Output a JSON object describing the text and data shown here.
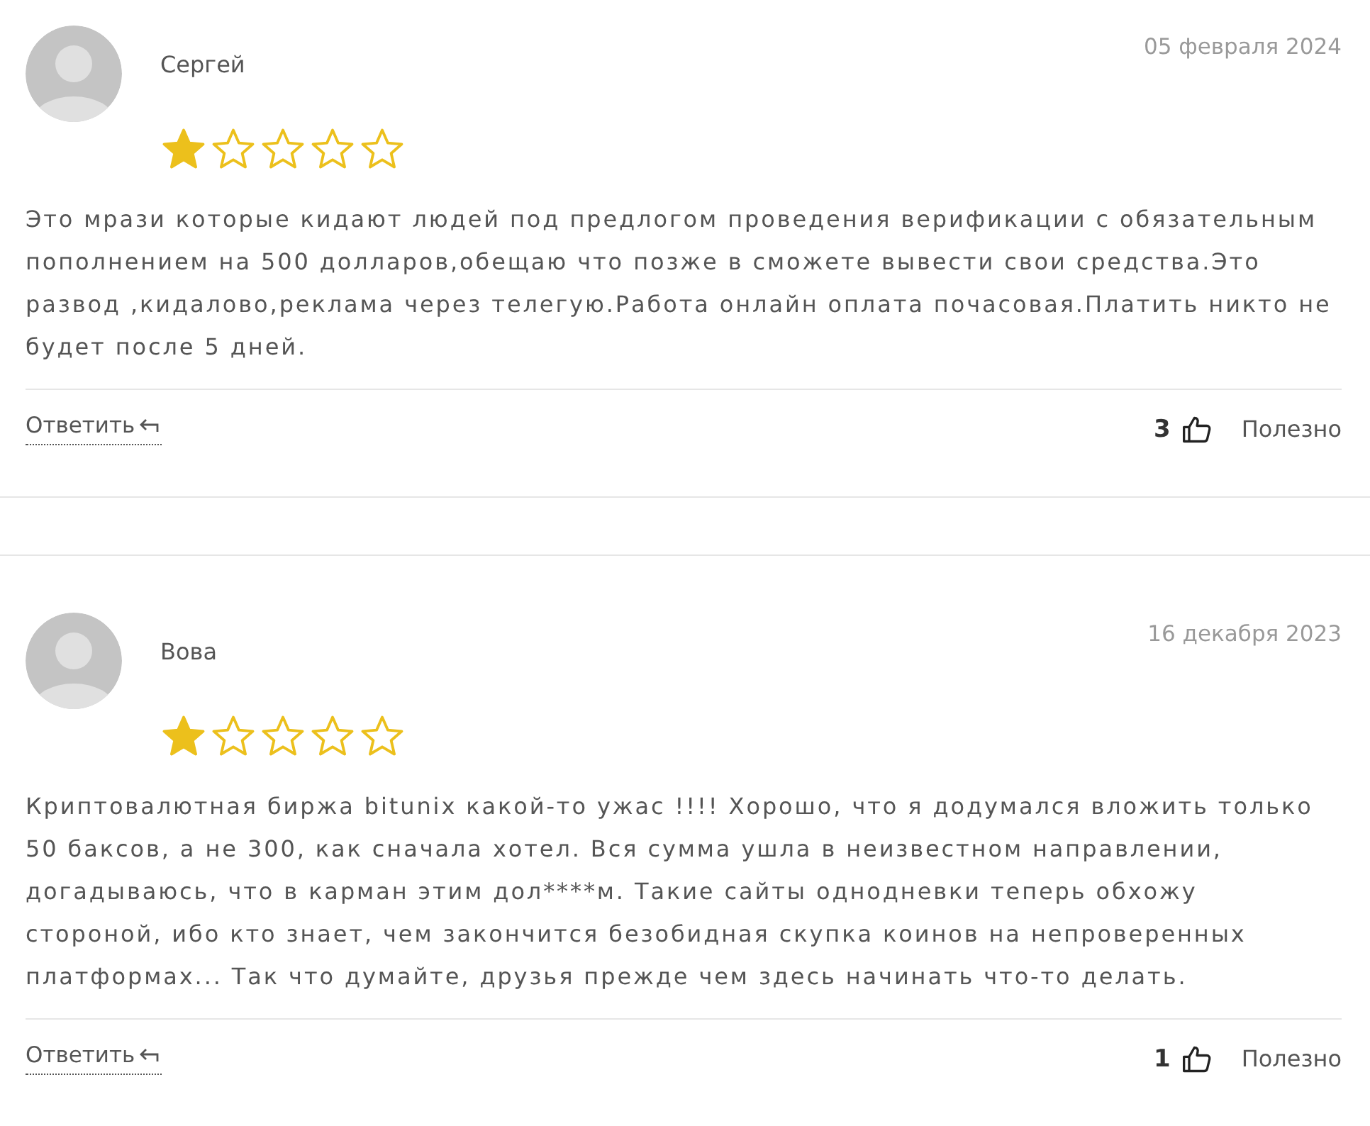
{
  "reviews": [
    {
      "author": "Сергей",
      "date": "05 февраля 2024",
      "stars": 1,
      "text": "Это мрази которые кидают людей под предлогом проведения верификации с обязательным пополнением на 500 долларов,обещаю что позже в сможете вывести свои средства.Это развод ,кидалово,реклама через телегую.Работа онлайн оплата почасовая.Платить никто не будет после 5 дней.",
      "reply": "Ответить",
      "likes": "3",
      "helpful": "Полезно"
    },
    {
      "author": "Вова",
      "date": "16 декабря 2023",
      "stars": 1,
      "text": "Криптовалютная биржа bitunix какой-то ужас !!!! Хорошо, что я додумался вложить только 50 баксов, а не 300, как сначала хотел. Вся сумма ушла в неизвестном направлении, догадываюсь, что в карман этим дол****м. Такие сайты однодневки теперь обхожу стороной, ибо кто знает, чем закончится безобидная скупка коинов на непроверенных платформах... Так что думайте, друзья прежде чем здесь начинать что-то делать.",
      "reply": "Ответить",
      "likes": "1",
      "helpful": "Полезно"
    }
  ]
}
